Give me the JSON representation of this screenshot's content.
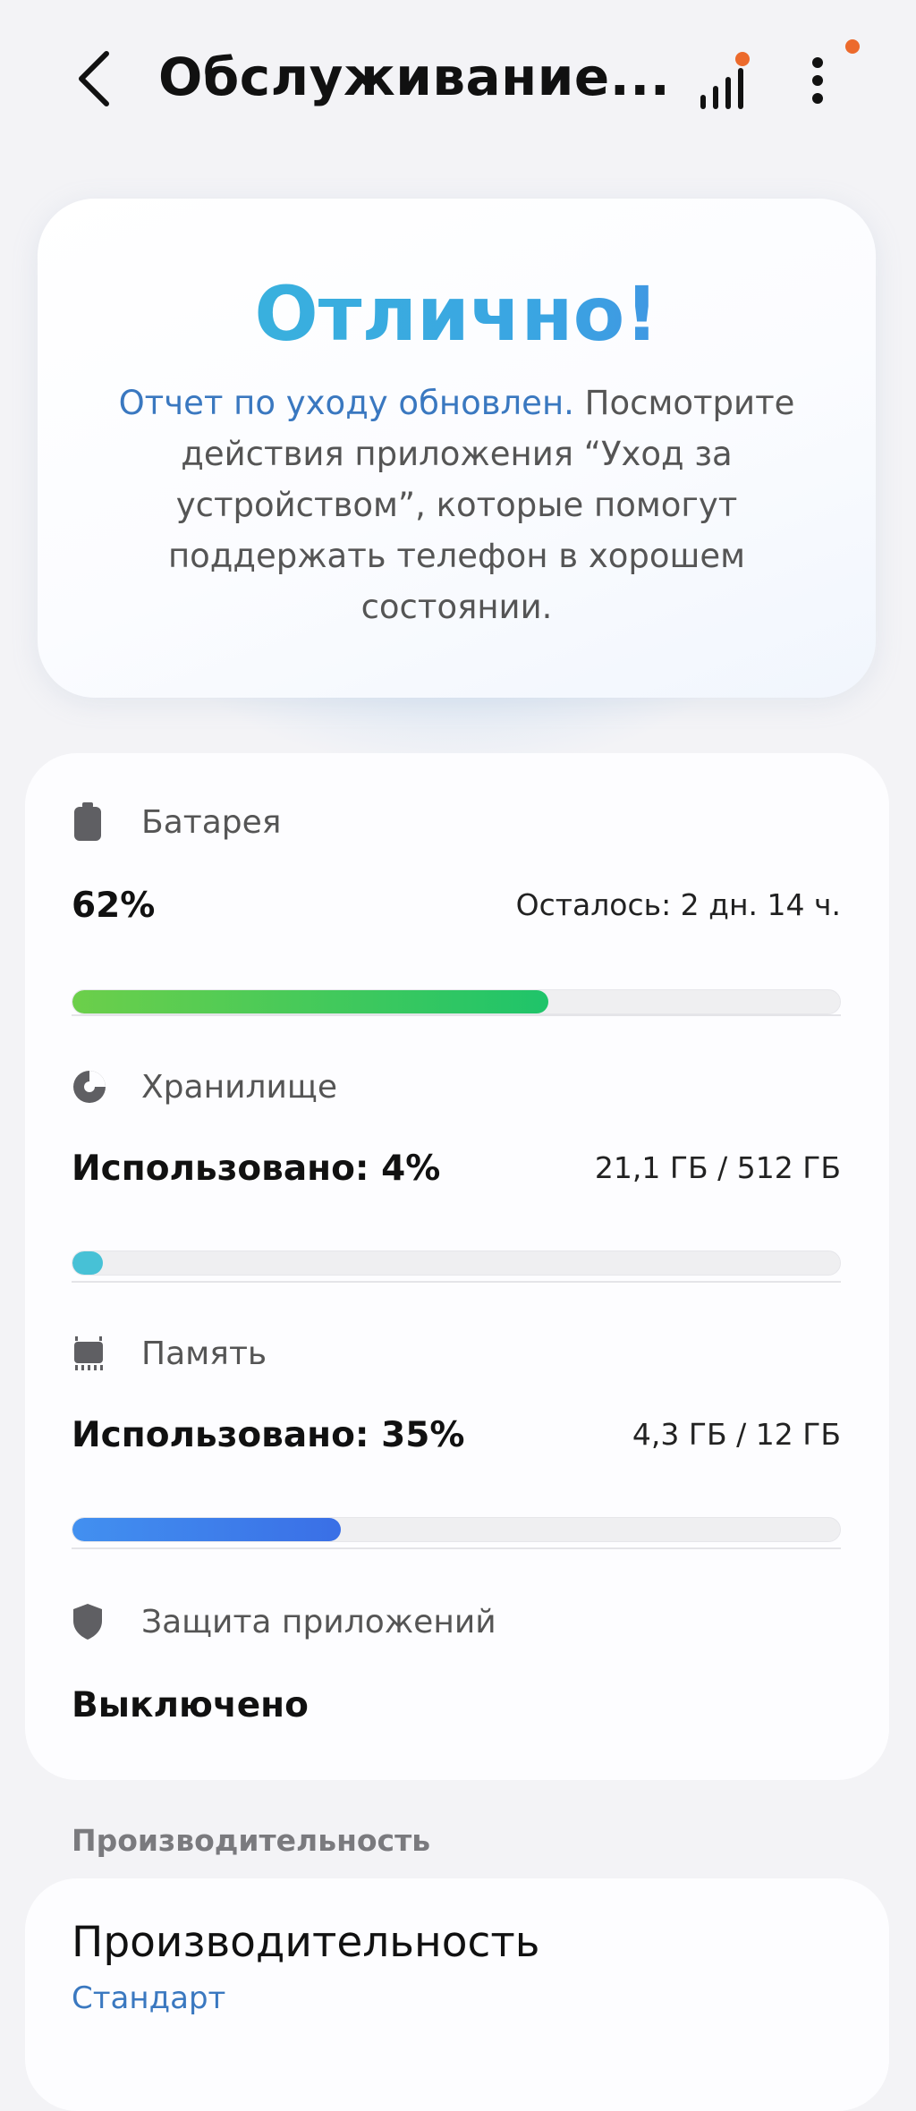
{
  "header": {
    "title": "Обслуживание...",
    "back_icon": "chevron-left-icon",
    "stats_icon": "bar-chart-icon",
    "more_icon": "more-vertical-icon",
    "notification_color": "#ec6a2c"
  },
  "hero": {
    "status_title": "Отлично!",
    "report_link": "Отчет по уходу обновлен.",
    "description": " Посмотрите действия приложения “Уход за устройством”, которые помогут поддержать телефон в хорошем состоянии."
  },
  "battery": {
    "label": "Батарея",
    "icon": "battery-icon",
    "percent_text": "62%",
    "percent": 62,
    "remaining": "Осталось: 2 дн. 14 ч.",
    "color": "#1fc46a"
  },
  "storage": {
    "label": "Хранилище",
    "icon": "pie-chart-icon",
    "used_text": "Использовано: 4%",
    "percent": 4,
    "amount": "21,1 ГБ / 512 ГБ",
    "color": "#47c1d6"
  },
  "memory": {
    "label": "Память",
    "icon": "memory-chip-icon",
    "used_text": "Использовано: 35%",
    "percent": 35,
    "amount": "4,3 ГБ / 12 ГБ",
    "color": "#3a6fe6"
  },
  "app_protection": {
    "label": "Защита приложений",
    "icon": "shield-icon",
    "status": "Выключено"
  },
  "performance": {
    "section_heading": "Производительность",
    "title": "Производительность",
    "value": "Стандарт"
  }
}
